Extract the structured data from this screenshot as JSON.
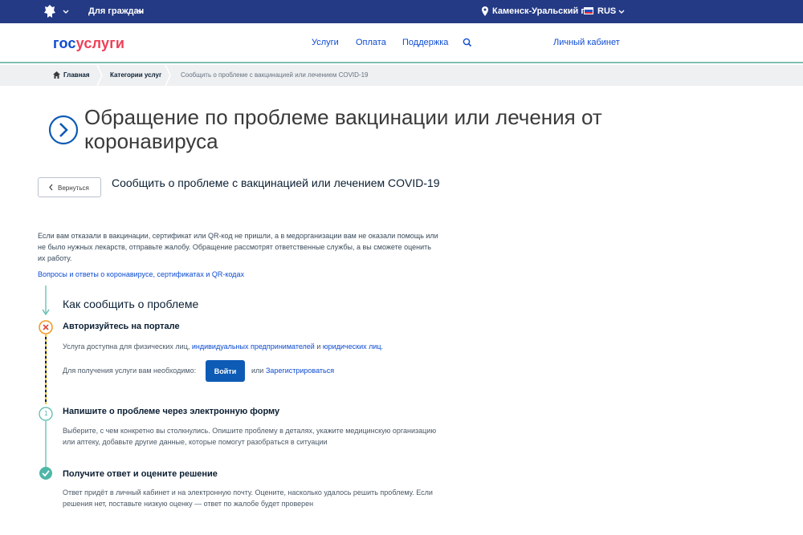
{
  "topbar": {
    "for_citizens": "Для граждан",
    "city": "Каменск-Уральский г",
    "lang": "RUS"
  },
  "header": {
    "logo_gos": "гос",
    "logo_uslugi": "услуги",
    "nav": [
      "Услуги",
      "Оплата",
      "Поддержка"
    ],
    "cabinet": "Личный кабинет"
  },
  "breadcrumb": {
    "home": "Главная",
    "categories": "Категории услуг",
    "current": "Сообщить о проблеме с вакцинацией или лечением COVID-19"
  },
  "page": {
    "title": "Обращение по проблеме вакцинации или лечения от коронавируса",
    "back": "Вернуться",
    "subtitle": "Сообщить о проблеме с вакцинацией или лечением COVID-19",
    "intro": "Если вам отказали в вакцинации, сертификат или QR-код не пришли, а в медорганизации вам не оказали помощь или не было нужных лекарств, отправьте жалобу. Обращение рассмотрят ответственные службы, а вы сможете оценить их работу.",
    "faq_link": "Вопросы и ответы о коронавирусе, сертификатах и QR-кодах"
  },
  "steps": {
    "heading": "Как сообщить о проблеме",
    "step1": {
      "title": "Авторизуйтесь на портале",
      "text_a": "Услуга доступна для физических лиц, ",
      "link_a": "индивидуальных предпринимателей",
      "text_b": " и ",
      "link_b": "юридических лиц",
      "text_c": ".",
      "need": "Для получения услуги вам необходимо:",
      "login": "Войти",
      "or": "или",
      "register": "Зарегистрироваться"
    },
    "step2": {
      "number": "1",
      "title": "Напишите о проблеме через электронную форму",
      "text": "Выберите, с чем конкретно вы столкнулись. Опишите проблему в деталях, укажите медицинскую организацию или аптеку, добавьте другие данные, которые помогут разобраться в ситуации"
    },
    "step3": {
      "title": "Получите ответ и оцените решение",
      "text": "Ответ придёт в личный кабинет и на электронную почту. Оцените, насколько удалось решить проблему. Если решения нет, поставьте низкую оценку — ответ по жалобе будет проверен"
    }
  },
  "colors": {
    "topbar": "#243a85",
    "link": "#0d4cd3",
    "accent_teal": "#4fb7a8",
    "warning_orange": "#f59a23",
    "error_red": "#e0473c",
    "button": "#0d5bb5"
  }
}
